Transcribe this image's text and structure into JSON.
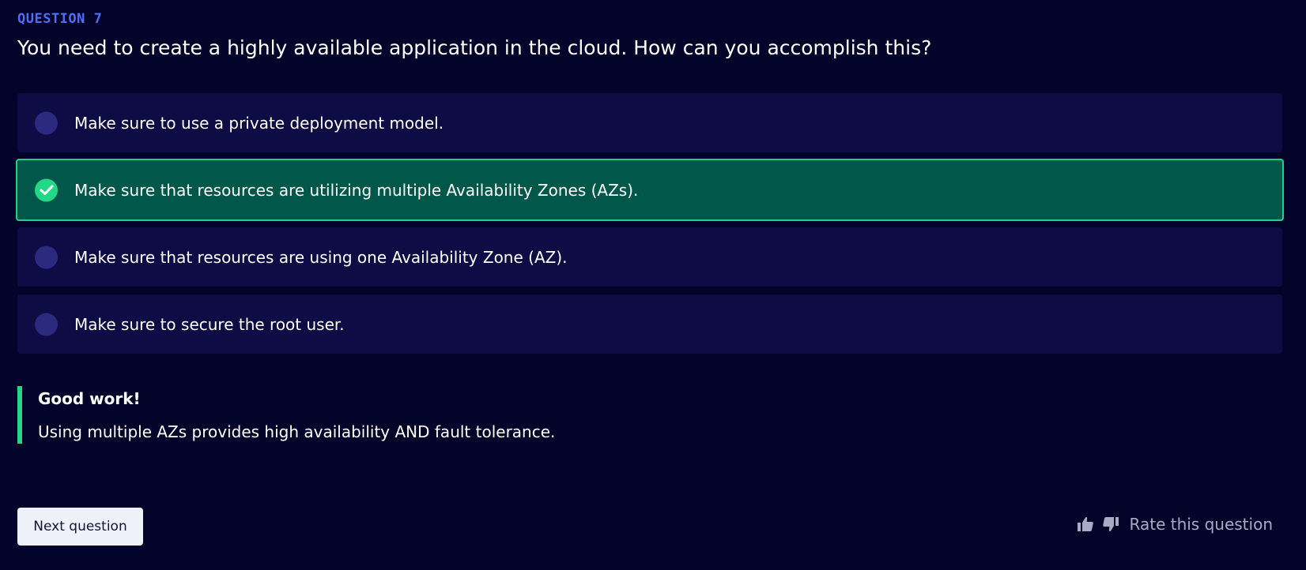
{
  "question": {
    "label": "QUESTION 7",
    "text": "You need to create a highly available application in the cloud. How can you accomplish this?"
  },
  "options": [
    {
      "label": "Make sure to use a private deployment model.",
      "selected": false
    },
    {
      "label": "Make sure that resources are utilizing multiple Availability Zones (AZs).",
      "selected": true
    },
    {
      "label": "Make sure that resources are using one Availability Zone (AZ).",
      "selected": false
    },
    {
      "label": "Make sure to secure the root user.",
      "selected": false
    }
  ],
  "feedback": {
    "title": "Good work!",
    "body": "Using multiple AZs provides high availability AND fault tolerance."
  },
  "footer": {
    "next_label": "Next question",
    "rate_label": "Rate this question",
    "thumbs_up_icon": "thumbs-up-icon",
    "thumbs_down_icon": "thumbs-down-icon"
  },
  "colors": {
    "background": "#03042a",
    "question_label": "#4f6ef7",
    "option_bg": "#0e0c45",
    "selected_bg": "#02574b",
    "selected_border": "#1fd08a",
    "check_green": "#22d886",
    "radio_unselected": "#2b2a80"
  }
}
